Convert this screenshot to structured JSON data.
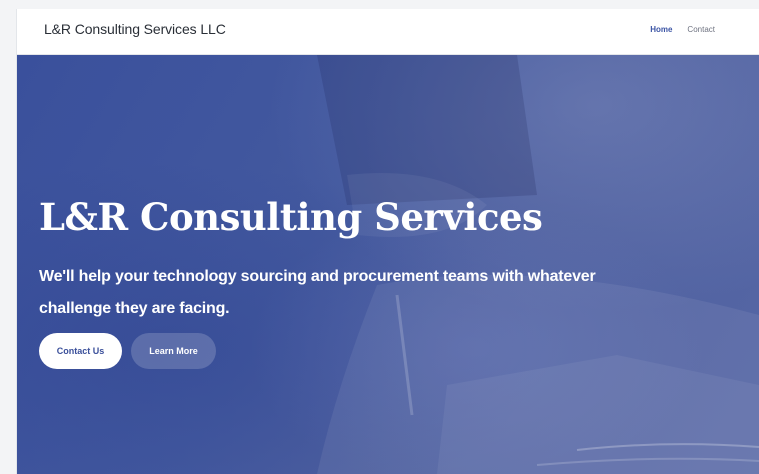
{
  "navbar": {
    "brand": "L&R Consulting Services LLC",
    "links": [
      {
        "label": "Home",
        "active": true
      },
      {
        "label": "Contact",
        "active": false
      }
    ]
  },
  "hero": {
    "title": "L&R Consulting Services",
    "subtitle": "We'll help your technology sourcing and procurement teams with whatever challenge they are facing.",
    "primary_button": "Contact Us",
    "secondary_button": "Learn More"
  },
  "colors": {
    "accent": "#3b54a5",
    "hero_overlay": "#3a509c",
    "text_dark": "#2a2f37"
  }
}
